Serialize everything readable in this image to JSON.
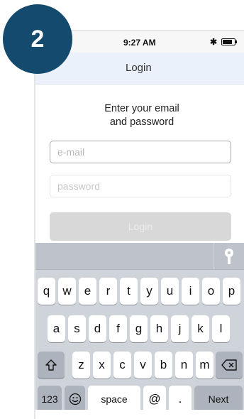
{
  "step": {
    "number": "2"
  },
  "status_bar": {
    "time": "9:27 AM",
    "bluetooth_icon": "bluetooth-icon",
    "battery_icon": "battery-icon"
  },
  "nav": {
    "title": "Login"
  },
  "form": {
    "heading_line1": "Enter your email",
    "heading_line2": "and password",
    "email_placeholder": "e-mail",
    "password_placeholder": "password",
    "login_label": "Login"
  },
  "keyboard": {
    "accessory_icon": "key-icon",
    "row1": [
      "q",
      "w",
      "e",
      "r",
      "t",
      "y",
      "u",
      "i",
      "o",
      "p"
    ],
    "row2": [
      "a",
      "s",
      "d",
      "f",
      "g",
      "h",
      "j",
      "k",
      "l"
    ],
    "row3": [
      "z",
      "x",
      "c",
      "v",
      "b",
      "n",
      "m"
    ],
    "shift_icon": "shift-icon",
    "delete_icon": "delete-icon",
    "numbers_label": "123",
    "emoji_icon": "emoji-icon",
    "space_label": "space",
    "at_label": "@",
    "dot_label": ".",
    "next_label": "Next"
  },
  "colors": {
    "badge": "#134a6e",
    "nav_bg": "#eaf1fb",
    "keyboard_bg": "#cfd4db"
  }
}
